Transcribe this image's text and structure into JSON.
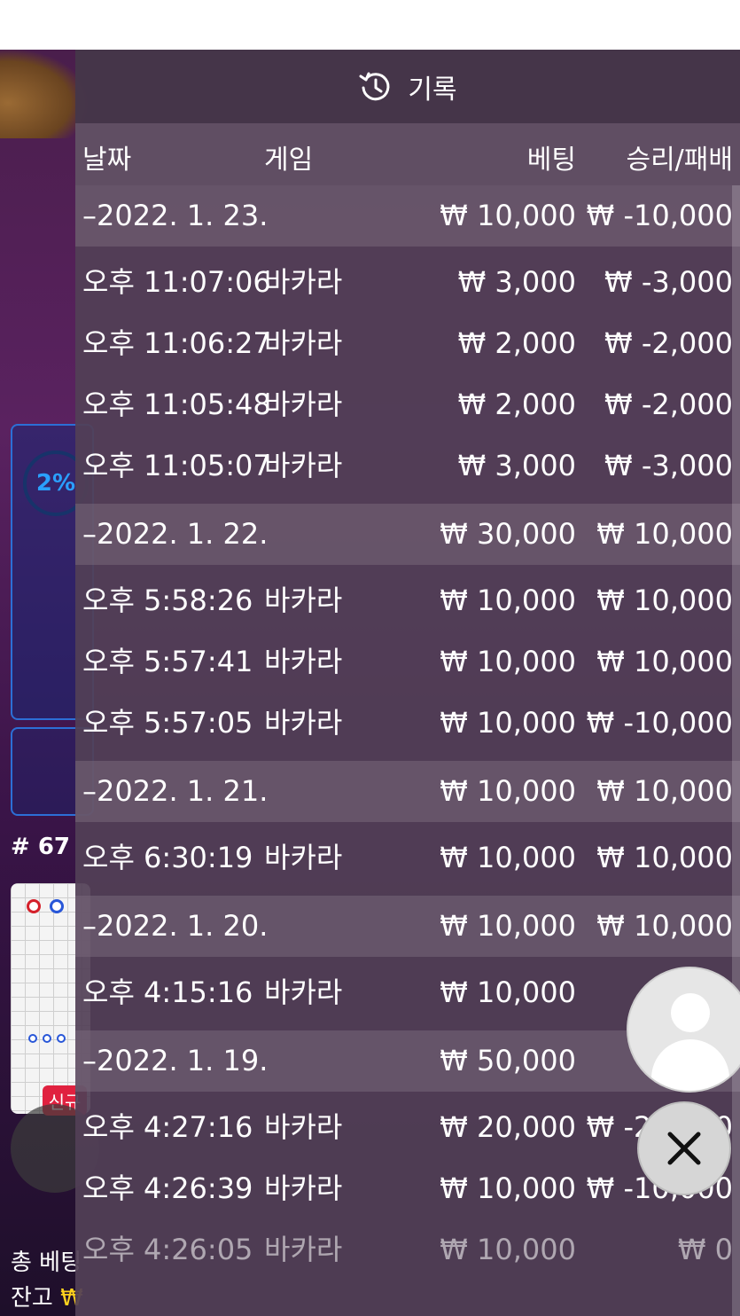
{
  "panel": {
    "title": "기록",
    "columns": {
      "date": "날짜",
      "game": "게임",
      "bet": "베팅",
      "result": "승리/패배"
    },
    "rows": [
      {
        "kind": "day",
        "date": "–2022. 1. 23.",
        "game": "",
        "bet": "₩ 10,000",
        "result": "₩ -10,000"
      },
      {
        "kind": "item",
        "date": "오후 11:07:06",
        "game": "바카라",
        "bet": "₩ 3,000",
        "result": "₩ -3,000"
      },
      {
        "kind": "item",
        "date": "오후 11:06:27",
        "game": "바카라",
        "bet": "₩ 2,000",
        "result": "₩ -2,000"
      },
      {
        "kind": "item",
        "date": "오후 11:05:48",
        "game": "바카라",
        "bet": "₩ 2,000",
        "result": "₩ -2,000"
      },
      {
        "kind": "item",
        "date": "오후 11:05:07",
        "game": "바카라",
        "bet": "₩ 3,000",
        "result": "₩ -3,000"
      },
      {
        "kind": "day",
        "date": "–2022. 1. 22.",
        "game": "",
        "bet": "₩ 30,000",
        "result": "₩ 10,000"
      },
      {
        "kind": "item",
        "date": "오후 5:58:26",
        "game": "바카라",
        "bet": "₩ 10,000",
        "result": "₩ 10,000"
      },
      {
        "kind": "item",
        "date": "오후 5:57:41",
        "game": "바카라",
        "bet": "₩ 10,000",
        "result": "₩ 10,000"
      },
      {
        "kind": "item",
        "date": "오후 5:57:05",
        "game": "바카라",
        "bet": "₩ 10,000",
        "result": "₩ -10,000"
      },
      {
        "kind": "day",
        "date": "–2022. 1. 21.",
        "game": "",
        "bet": "₩ 10,000",
        "result": "₩ 10,000"
      },
      {
        "kind": "item",
        "date": "오후 6:30:19",
        "game": "바카라",
        "bet": "₩ 10,000",
        "result": "₩ 10,000"
      },
      {
        "kind": "day",
        "date": "–2022. 1. 20.",
        "game": "",
        "bet": "₩ 10,000",
        "result": "₩ 10,000"
      },
      {
        "kind": "item",
        "date": "오후 4:15:16",
        "game": "바카라",
        "bet": "₩ 10,000",
        "result": "₩ 1"
      },
      {
        "kind": "day",
        "date": "–2022. 1. 19.",
        "game": "",
        "bet": "₩ 50,000",
        "result": "₩ -"
      },
      {
        "kind": "item",
        "date": "오후 4:27:16",
        "game": "바카라",
        "bet": "₩ 20,000",
        "result": "₩ -20,000"
      },
      {
        "kind": "item",
        "date": "오후 4:26:39",
        "game": "바카라",
        "bet": "₩ 10,000",
        "result": "₩ -10,000"
      },
      {
        "kind": "item",
        "date": "오후 4:26:05",
        "game": "바카라",
        "bet": "₩ 10,000",
        "result": "₩ 0"
      }
    ]
  },
  "background": {
    "gauge_percent": "2%",
    "round_label": "# 67",
    "new_badge": "신규",
    "total_bet_label": "총 베팅",
    "balance_label": "잔고",
    "balance_currency": "₩"
  },
  "icons": {
    "history": "history-icon",
    "avatar": "avatar-icon",
    "close": "close-icon"
  },
  "colors": {
    "panel": "#524056",
    "accent_blue": "#2aa0ff",
    "badge_red": "#e0213f",
    "balance_yellow": "#ffd21e"
  }
}
